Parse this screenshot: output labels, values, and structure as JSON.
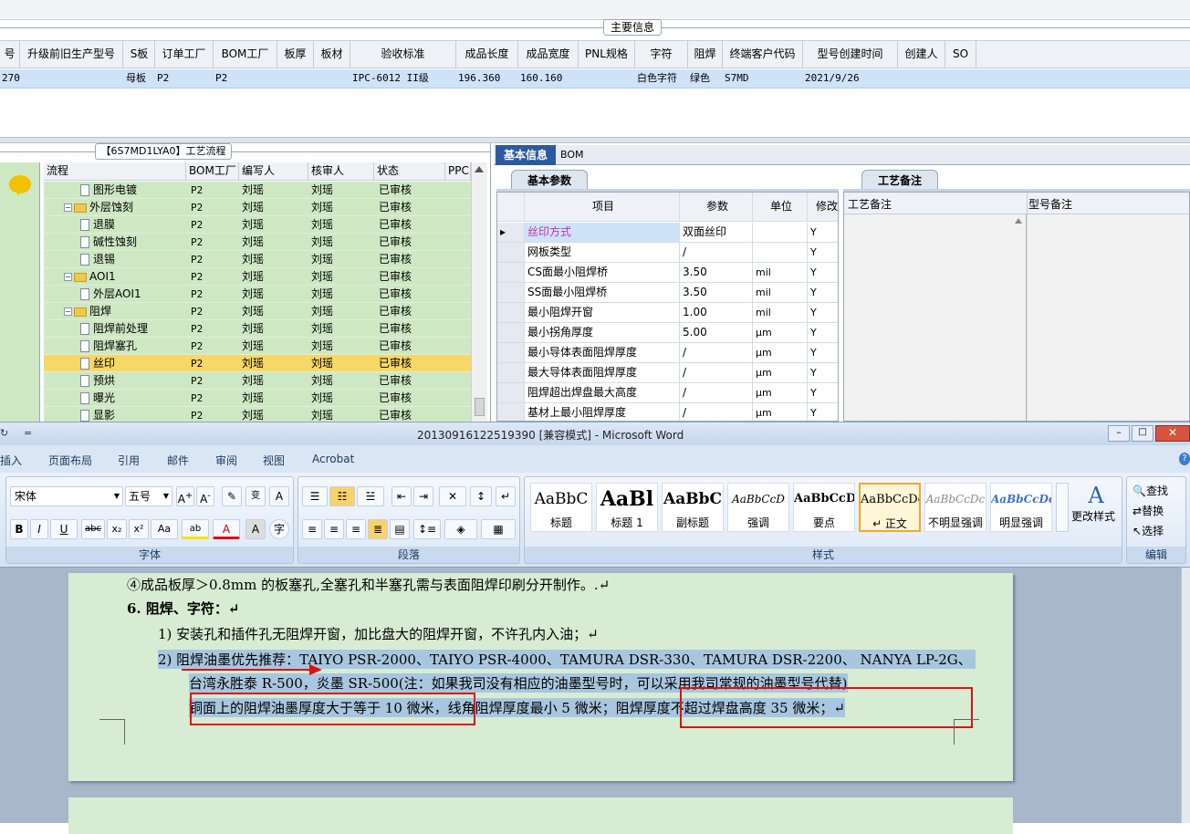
{
  "top_grid": {
    "group_title": "主要信息",
    "columns": [
      "号",
      "升级前旧生产型号",
      "S板",
      "订单工厂",
      "BOM工厂",
      "板厚",
      "板材",
      "验收标准",
      "成品长度",
      "成品宽度",
      "PNL规格",
      "字符",
      "阻焊",
      "终端客户代码",
      "型号创建时间",
      "创建人",
      "SO"
    ],
    "row": [
      "270",
      "",
      "母板",
      "P2",
      "P2",
      "",
      "",
      "IPC-6012 II级",
      "196.360",
      "160.160",
      "",
      "白色字符",
      "绿色",
      "S7MD",
      "2021/9/26",
      "",
      ""
    ]
  },
  "process_panel": {
    "title": "【6S7MD1LYA0】工艺流程",
    "columns": [
      "流程",
      "BOM工厂",
      "编写人",
      "核审人",
      "状态",
      "PPC"
    ],
    "rows": [
      {
        "name": "图形电镀",
        "type": "doc",
        "level": 2,
        "bom": "P2",
        "writer": "刘瑶",
        "reviewer": "刘瑶",
        "status": "已审核"
      },
      {
        "name": "外层蚀刻",
        "type": "folder",
        "level": 1,
        "bom": "P2",
        "writer": "刘瑶",
        "reviewer": "刘瑶",
        "status": "已审核"
      },
      {
        "name": "退膜",
        "type": "doc",
        "level": 2,
        "bom": "P2",
        "writer": "刘瑶",
        "reviewer": "刘瑶",
        "status": "已审核"
      },
      {
        "name": "碱性蚀刻",
        "type": "doc",
        "level": 2,
        "bom": "P2",
        "writer": "刘瑶",
        "reviewer": "刘瑶",
        "status": "已审核"
      },
      {
        "name": "退锡",
        "type": "doc",
        "level": 2,
        "bom": "P2",
        "writer": "刘瑶",
        "reviewer": "刘瑶",
        "status": "已审核"
      },
      {
        "name": "AOI1",
        "type": "folder",
        "level": 1,
        "bom": "P2",
        "writer": "刘瑶",
        "reviewer": "刘瑶",
        "status": "已审核"
      },
      {
        "name": "外层AOI1",
        "type": "doc",
        "level": 2,
        "bom": "P2",
        "writer": "刘瑶",
        "reviewer": "刘瑶",
        "status": "已审核"
      },
      {
        "name": "阻焊",
        "type": "folder",
        "level": 1,
        "bom": "P2",
        "writer": "刘瑶",
        "reviewer": "刘瑶",
        "status": "已审核"
      },
      {
        "name": "阻焊前处理",
        "type": "doc",
        "level": 2,
        "bom": "P2",
        "writer": "刘瑶",
        "reviewer": "刘瑶",
        "status": "已审核"
      },
      {
        "name": "阻焊塞孔",
        "type": "doc",
        "level": 2,
        "bom": "P2",
        "writer": "刘瑶",
        "reviewer": "刘瑶",
        "status": "已审核"
      },
      {
        "name": "丝印",
        "type": "doc",
        "level": 2,
        "bom": "P2",
        "writer": "刘瑶",
        "reviewer": "刘瑶",
        "status": "已审核",
        "selected": true
      },
      {
        "name": "预烘",
        "type": "doc",
        "level": 2,
        "bom": "P2",
        "writer": "刘瑶",
        "reviewer": "刘瑶",
        "status": "已审核"
      },
      {
        "name": "曝光",
        "type": "doc",
        "level": 2,
        "bom": "P2",
        "writer": "刘瑶",
        "reviewer": "刘瑶",
        "status": "已审核"
      },
      {
        "name": "显影",
        "type": "doc",
        "level": 2,
        "bom": "P2",
        "writer": "刘瑶",
        "reviewer": "刘瑶",
        "status": "已审核"
      }
    ]
  },
  "right_panel": {
    "tab_basic": "基本信息",
    "tab_bom": "BOM",
    "subtab_params": "基本参数",
    "subtab_notes": "工艺备注",
    "param_columns": [
      "项目",
      "参数",
      "单位",
      "修改"
    ],
    "params": [
      {
        "item": "丝印方式",
        "value": "双面丝印",
        "unit": "",
        "mod": "Y",
        "pink": true
      },
      {
        "item": "网板类型",
        "value": "/",
        "unit": "",
        "mod": "Y"
      },
      {
        "item": "CS面最小阻焊桥",
        "value": "3.50",
        "unit": "mil",
        "mod": "Y"
      },
      {
        "item": "SS面最小阻焊桥",
        "value": "3.50",
        "unit": "mil",
        "mod": "Y"
      },
      {
        "item": "最小阻焊开窗",
        "value": "1.00",
        "unit": "mil",
        "mod": "Y"
      },
      {
        "item": "最小拐角厚度",
        "value": "5.00",
        "unit": "μm",
        "mod": "Y"
      },
      {
        "item": "最小导体表面阻焊厚度",
        "value": "/",
        "unit": "μm",
        "mod": "Y"
      },
      {
        "item": "最大导体表面阻焊厚度",
        "value": "/",
        "unit": "μm",
        "mod": "Y"
      },
      {
        "item": "阻焊超出焊盘最大高度",
        "value": "/",
        "unit": "μm",
        "mod": "Y"
      },
      {
        "item": "基材上最小阻焊厚度",
        "value": "/",
        "unit": "μm",
        "mod": "Y"
      }
    ],
    "notes_col1": "工艺备注",
    "notes_col2": "型号备注"
  },
  "word": {
    "title": "20130916122519390 [兼容模式] - Microsoft Word",
    "menu": [
      "插入",
      "页面布局",
      "引用",
      "邮件",
      "审阅",
      "视图",
      "Acrobat"
    ],
    "font_name": "宋体",
    "font_size": "五号",
    "group_font": "字体",
    "group_para": "段落",
    "group_styles": "样式",
    "group_edit": "编辑",
    "styles": [
      {
        "sample": "AaBbC",
        "name": "标题"
      },
      {
        "sample": "AaBl",
        "name": "标题 1"
      },
      {
        "sample": "AaBbC",
        "name": "副标题"
      },
      {
        "sample": "AaBbCcD",
        "name": "强调"
      },
      {
        "sample": "AaBbCcD",
        "name": "要点"
      },
      {
        "sample": "AaBbCcDc",
        "name": "↵ 正文"
      },
      {
        "sample": "AaBbCcDc",
        "name": "不明显强调"
      },
      {
        "sample": "AaBbCcDc",
        "name": "明显强调"
      }
    ],
    "change_styles": "更改样式",
    "edit_find": "查找",
    "edit_replace": "替换",
    "edit_select": "选择",
    "doc_lines": [
      "④成品板厚＞0.8mm 的板塞孔,全塞孔和半塞孔需与表面阻焊印刷分开制作。.↵",
      "6.   阻焊、字符：↵",
      "1)  安装孔和插件孔无阻焊开窗，加比盘大的阻焊开窗，不许孔内入油；↵",
      "2)  阻焊油墨优先推荐：TAIYO PSR-2000、TAIYO PSR-4000、TAMURA   DSR-330、TAMURA DSR-2200、 NANYA LP-2G、",
      "台湾永胜泰 R-500，炎墨 SR-500(注：如果我司没有相应的油墨型号时，可以采用我司常规的油墨型号代替)",
      "铜面上的阻焊油墨厚度大于等于 10 微米，线角阻焊厚度最小 5 微米；阻焊厚度不超过焊盘高度 35 微米；↵"
    ]
  }
}
